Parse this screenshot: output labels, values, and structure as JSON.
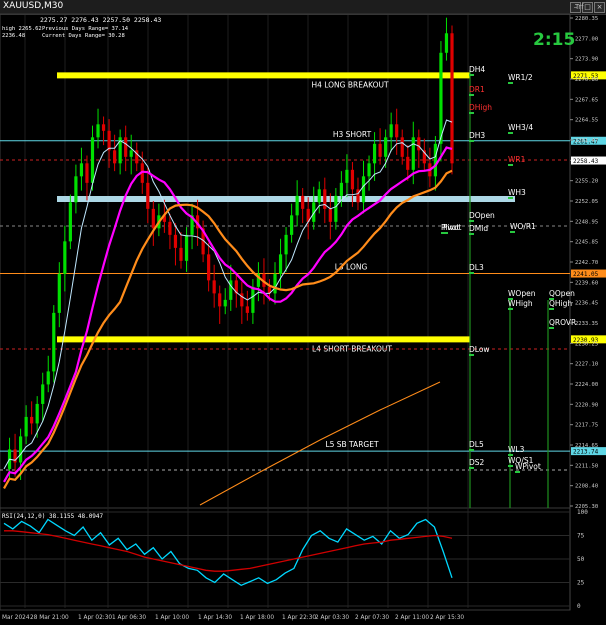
{
  "window": {
    "symbol_title": "XAUUSD,M30",
    "ohlc": "2275.27 2276.43 2257.50 2258.43",
    "info_lines": [
      "high 2265.62",
      "Previous Days Range= 37.14",
      "Current Days Range= 30.28",
      "2236.48"
    ],
    "countdown": "2:15",
    "brand_fragment": "Trf"
  },
  "levels": [
    {
      "label": "H4 LONG BREAKOUT",
      "price": 2271.53,
      "color": "#ffff00",
      "tag": "2271.53"
    },
    {
      "label": "H3 SHORT",
      "price": 2261.47,
      "color": "#5fd7e6",
      "tag": "2261.47"
    },
    {
      "label": "L3 LONG",
      "price": 2241.05,
      "color": "#ff8c1a",
      "tag": "2241.05"
    },
    {
      "label": "L4 SHORT BREAKOUT",
      "price": 2230.93,
      "color": "#ffff00",
      "tag": "2230.93"
    },
    {
      "label": "L5 SB TARGET",
      "price": 2213.74,
      "color": "#5fd7e6",
      "tag": "2213.74"
    }
  ],
  "markers": [
    {
      "text": "DH4",
      "color": "#ffffff"
    },
    {
      "text": "WR1/2",
      "color": "#ffffff"
    },
    {
      "text": "DR1",
      "color": "#ff3030"
    },
    {
      "text": "DHigh",
      "color": "#ff3030"
    },
    {
      "text": "WH3/4",
      "color": "#ffffff"
    },
    {
      "text": "DH3",
      "color": "#ffffff"
    },
    {
      "text": "WR1",
      "color": "#ff3030"
    },
    {
      "text": "WH3",
      "color": "#ffffff"
    },
    {
      "text": "DOpen",
      "color": "#ffffff"
    },
    {
      "text": "Pivot",
      "color": "#ffffff"
    },
    {
      "text": "WO/R1",
      "color": "#ffffff"
    },
    {
      "text": "DMid",
      "color": "#ffffff"
    },
    {
      "text": "Pivot",
      "color": "#ffffff"
    },
    {
      "text": "DL3",
      "color": "#ffffff"
    },
    {
      "text": "WOpen",
      "color": "#ffffff"
    },
    {
      "text": "QOpen",
      "color": "#ffffff"
    },
    {
      "text": "WHigh",
      "color": "#ffffff"
    },
    {
      "text": "QHigh",
      "color": "#ffffff"
    },
    {
      "text": "QROVR",
      "color": "#ffffff"
    },
    {
      "text": "DLow",
      "color": "#ffffff"
    },
    {
      "text": "DL5",
      "color": "#ffffff"
    },
    {
      "text": "WL3",
      "color": "#ffffff"
    },
    {
      "text": "DS2",
      "color": "#ffffff"
    },
    {
      "text": "WO/S1",
      "color": "#ffffff"
    },
    {
      "text": "WPivot",
      "color": "#ffffff"
    }
  ],
  "price_axis": {
    "ticks": [
      "2280.35",
      "2277.00",
      "2273.90",
      "2270.80",
      "2267.65",
      "2264.55",
      "2261.47",
      "2258.30",
      "2255.20",
      "2252.05",
      "2248.95",
      "2245.85",
      "2242.70",
      "2239.60",
      "2236.45",
      "2233.35",
      "2230.25",
      "2227.10",
      "2224.00",
      "2220.90",
      "2217.75",
      "2214.65",
      "2211.50",
      "2208.40",
      "2205.30"
    ],
    "current_price": "2258.43"
  },
  "indicator": {
    "label": "RSI(24,12,0) 38.1155 48.0947",
    "ticks": [
      "100",
      "75",
      "50",
      "25",
      "0"
    ]
  },
  "time_axis": [
    "Mar 2024",
    "28 Mar 21:00",
    "1 Apr 02:30",
    "1 Apr 06:30",
    "1 Apr 10:00",
    "1 Apr 14:30",
    "1 Apr 18:00",
    "1 Apr 22:30",
    "2 Apr 03:30",
    "2 Apr 07:30",
    "2 Apr 11:00",
    "2 Apr 15:30"
  ],
  "colors": {
    "bull": "#00e000",
    "bear": "#e00000",
    "ma_fast": "#c0e8ff",
    "ma_mid": "#ff8c1a",
    "ma_slow": "#ff00ff",
    "rsi": "#00d8ff",
    "rsi_signal": "#d00000"
  }
}
